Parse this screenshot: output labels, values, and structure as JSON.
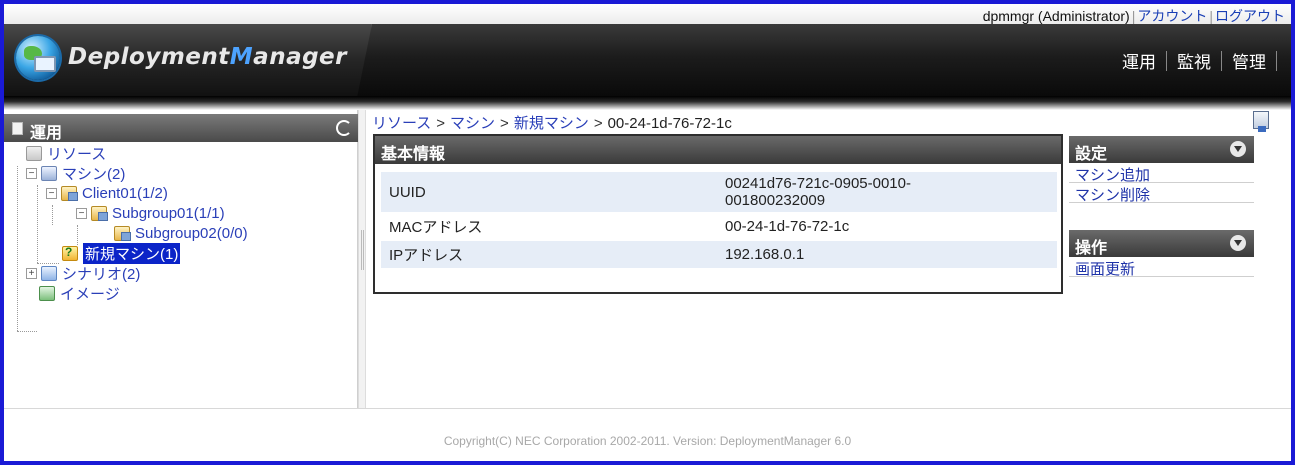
{
  "userbar": {
    "user": "dpmmgr (Administrator)",
    "account_link": "アカウント",
    "logout_link": "ログアウト"
  },
  "logo": {
    "prefix": "Deployment",
    "m": "M",
    "suffix": "anager"
  },
  "mainnav": {
    "items": [
      "運用",
      "監視",
      "管理"
    ]
  },
  "sidebar": {
    "title": "運用",
    "tree": {
      "resource": "リソース",
      "machine": "マシン(2)",
      "client01": "Client01(1/2)",
      "subgroup01": "Subgroup01(1/1)",
      "subgroup02": "Subgroup02(0/0)",
      "new_machine": "新規マシン(1)",
      "scenario": "シナリオ(2)",
      "image": "イメージ"
    }
  },
  "breadcrumb": {
    "items": [
      "リソース",
      "マシン",
      "新規マシン"
    ],
    "separator": ">",
    "current": "00-24-1d-76-72-1c"
  },
  "basic_info": {
    "title": "基本情報",
    "rows": [
      {
        "key": "UUID",
        "value_line1": "00241d76-721c-0905-0010-",
        "value_line2": "001800232009"
      },
      {
        "key": "MACアドレス",
        "value": "00-24-1d-76-72-1c"
      },
      {
        "key": "IPアドレス",
        "value": "192.168.0.1"
      }
    ]
  },
  "settings_panel": {
    "title": "設定",
    "items": [
      "マシン追加",
      "マシン削除"
    ]
  },
  "operations_panel": {
    "title": "操作",
    "items": [
      "画面更新"
    ]
  },
  "footer": {
    "copyright": "Copyright(C) NEC Corporation 2002-2011. Version: DeploymentManager 6.0"
  },
  "colors": {
    "frame": "#1a1ad6",
    "link": "#2a3fb8",
    "selected": "#0b24c8",
    "row_alt": "#e6edf7"
  }
}
